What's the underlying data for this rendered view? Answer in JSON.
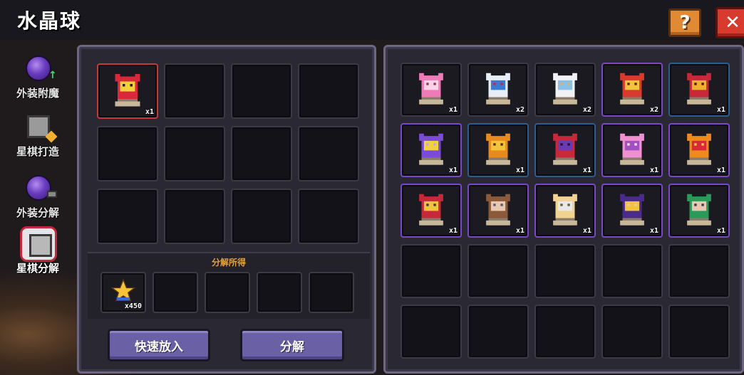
{
  "window": {
    "title": "水晶球"
  },
  "header": {
    "help_label": "?",
    "close_label": "✕"
  },
  "sidebar": {
    "items": [
      {
        "label": "外装附魔",
        "icon": "crystal-ball-enchant-icon",
        "active": false
      },
      {
        "label": "星棋打造",
        "icon": "chess-forge-icon",
        "active": false
      },
      {
        "label": "外装分解",
        "icon": "crystal-ball-decompose-icon",
        "active": false
      },
      {
        "label": "星棋分解",
        "icon": "chess-decompose-icon",
        "active": true
      }
    ]
  },
  "input_grid": {
    "slots": [
      {
        "item": "red-demon-chess-piece",
        "qty": "x1",
        "rarity": "red"
      },
      {},
      {},
      {},
      {},
      {},
      {},
      {},
      {},
      {},
      {},
      {}
    ]
  },
  "output": {
    "label": "分解所得",
    "slots": [
      {
        "item": "star-fragment",
        "qty": "x450"
      },
      {},
      {},
      {},
      {}
    ]
  },
  "actions": {
    "quick_add_label": "快速放入",
    "decompose_label": "分解"
  },
  "inventory": {
    "slots": [
      {
        "item": "pink-flower",
        "qty": "x1",
        "rarity": "none"
      },
      {
        "item": "white-bird",
        "qty": "x2",
        "rarity": "none"
      },
      {
        "item": "white-cat",
        "qty": "x2",
        "rarity": "none"
      },
      {
        "item": "red-bell",
        "qty": "x2",
        "rarity": "purple"
      },
      {
        "item": "red-ribbon",
        "qty": "x1",
        "rarity": "blue"
      },
      {
        "item": "purple-wand",
        "qty": "x1",
        "rarity": "purple"
      },
      {
        "item": "orange-pumpkin",
        "qty": "x1",
        "rarity": "blue"
      },
      {
        "item": "red-hood",
        "qty": "x1",
        "rarity": "blue"
      },
      {
        "item": "pink-wings",
        "qty": "x1",
        "rarity": "purple"
      },
      {
        "item": "fire-sword",
        "qty": "x1",
        "rarity": "purple"
      },
      {
        "item": "red-warrior",
        "qty": "x1",
        "rarity": "purple"
      },
      {
        "item": "brown-hair-girl",
        "qty": "x1",
        "rarity": "purple"
      },
      {
        "item": "blonde-knight",
        "qty": "x1",
        "rarity": "purple"
      },
      {
        "item": "witch-hat",
        "qty": "x1",
        "rarity": "purple"
      },
      {
        "item": "green-hood",
        "qty": "x1",
        "rarity": "purple"
      },
      {},
      {},
      {},
      {},
      {},
      {},
      {},
      {},
      {},
      {}
    ]
  },
  "colors": {
    "accent_red": "#c43a3a",
    "rarity_purple": "#7a47c8",
    "rarity_blue": "#2d5d8f",
    "button_purple": "#6a60a6",
    "label_orange": "#e4a23a"
  }
}
